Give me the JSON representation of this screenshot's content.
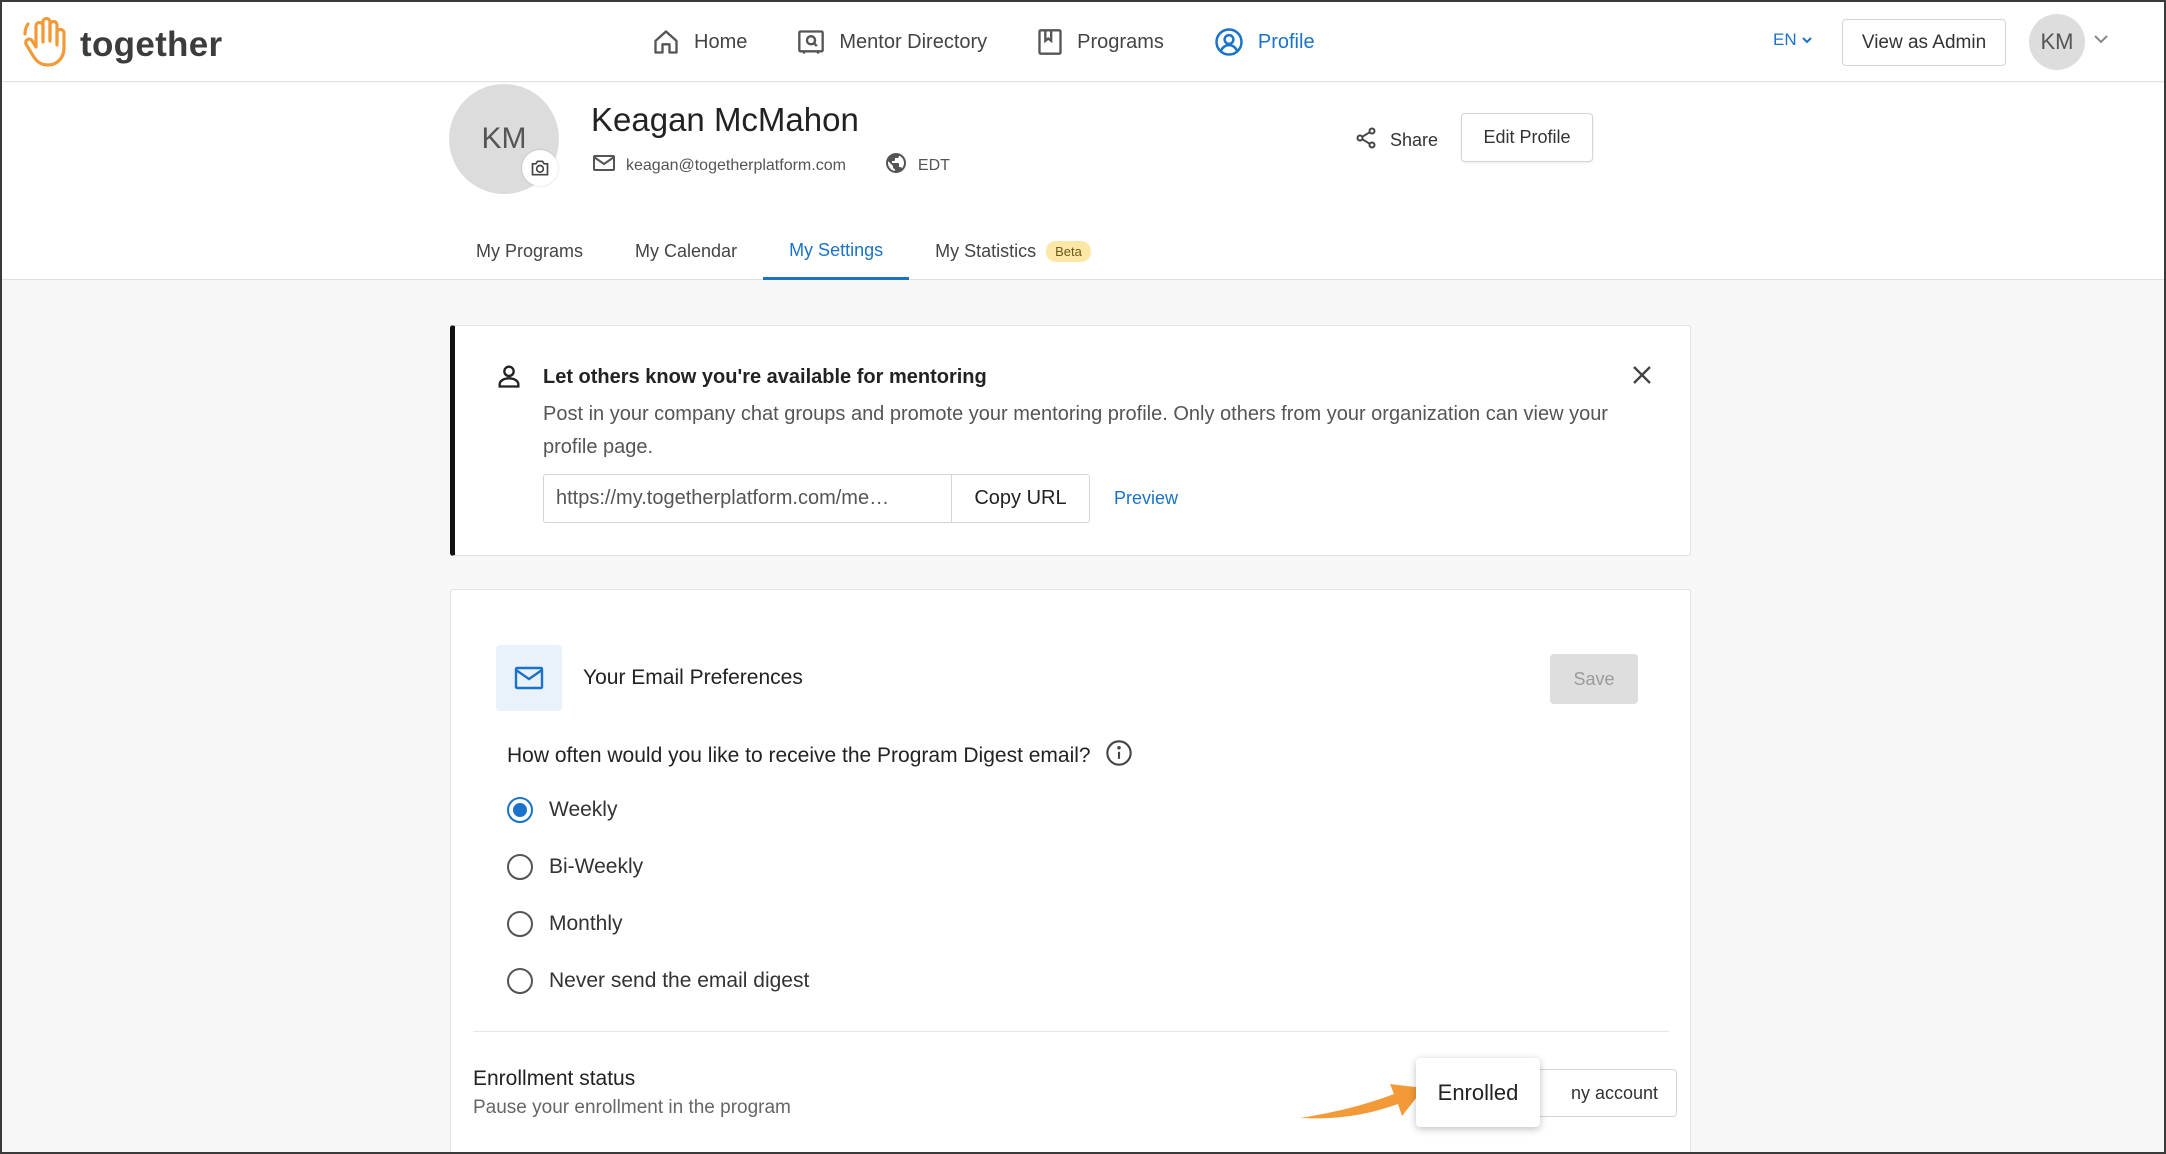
{
  "brand": {
    "name": "together",
    "accent": "#f29a38"
  },
  "nav": {
    "items": [
      {
        "label": "Home",
        "icon": "home-icon",
        "active": false
      },
      {
        "label": "Mentor Directory",
        "icon": "directory-icon",
        "active": false
      },
      {
        "label": "Programs",
        "icon": "book-icon",
        "active": false
      },
      {
        "label": "Profile",
        "icon": "profile-icon",
        "active": true
      }
    ],
    "language": "EN",
    "view_as_admin": "View as Admin",
    "avatar_initials": "KM"
  },
  "profile": {
    "initials": "KM",
    "name": "Keagan McMahon",
    "email": "keagan@togetherplatform.com",
    "timezone": "EDT",
    "share_label": "Share",
    "edit_label": "Edit Profile"
  },
  "tabs": [
    {
      "label": "My Programs",
      "active": false
    },
    {
      "label": "My Calendar",
      "active": false
    },
    {
      "label": "My Settings",
      "active": true
    },
    {
      "label": "My Statistics",
      "badge": "Beta",
      "active": false
    }
  ],
  "mentoring": {
    "title": "Let others know you're available for mentoring",
    "description": "Post in your company chat groups and promote your mentoring profile. Only others from your organization can view your profile page.",
    "url_value": "https://my.togetherplatform.com/me…",
    "copy_label": "Copy URL",
    "preview_label": "Preview"
  },
  "email_prefs": {
    "title": "Your Email Preferences",
    "save_label": "Save",
    "question": "How often would you like to receive the Program Digest email?",
    "options": [
      {
        "label": "Weekly",
        "checked": true
      },
      {
        "label": "Bi-Weekly",
        "checked": false
      },
      {
        "label": "Monthly",
        "checked": false
      },
      {
        "label": "Never send the email digest",
        "checked": false
      }
    ]
  },
  "enrollment": {
    "title": "Enrollment status",
    "subtitle": "Pause your enrollment in the program",
    "button_visible_text": "ny account",
    "tooltip": "Enrolled"
  },
  "colors": {
    "primary": "#1a73c8",
    "arrow": "#f29a38"
  }
}
